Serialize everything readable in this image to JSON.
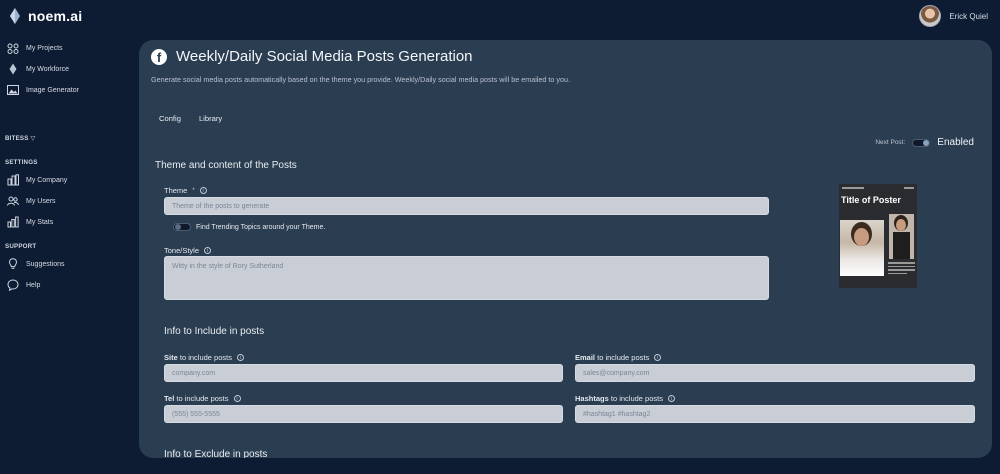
{
  "app": {
    "logo_text": "noem.ai",
    "user_name": "Erick Quiel"
  },
  "sidebar": {
    "items": [
      {
        "label": "My Projects",
        "icon": "projects-icon"
      },
      {
        "label": "My Workforce",
        "icon": "workforce-icon"
      },
      {
        "label": "Image Generator",
        "icon": "image-icon"
      }
    ],
    "bitess_label": "BITESS",
    "settings_label": "SETTINGS",
    "settings_items": [
      {
        "label": "My Company",
        "icon": "company-icon"
      },
      {
        "label": "My Users",
        "icon": "users-icon"
      },
      {
        "label": "My Stats",
        "icon": "stats-icon"
      }
    ],
    "support_label": "SUPPORT",
    "support_items": [
      {
        "label": "Suggestions",
        "icon": "lightbulb-icon"
      },
      {
        "label": "Help",
        "icon": "help-icon"
      }
    ]
  },
  "main": {
    "title": "Weekly/Daily Social Media Posts Generation",
    "subtitle": "Generate social media posts automatically based on the theme you provide. Weekly/Daily social media posts will be emailed to you.",
    "tabs": [
      {
        "label": "Config"
      },
      {
        "label": "Library"
      }
    ],
    "next_post_label": "Next Post:",
    "next_post_status": "Enabled",
    "theme_section_title": "Theme and content of the Posts",
    "theme": {
      "label": "Theme",
      "required_mark": "*",
      "placeholder": "Theme of the posts to generate"
    },
    "trending_label": "Find Trending Topics around your Theme.",
    "tone": {
      "label": "Tone/Style",
      "placeholder": "Witty in the style of Rory Sutherland"
    },
    "include_section_title": "Info to Include in posts",
    "site": {
      "label_bold": "Site",
      "label_rest": "to include posts",
      "placeholder": "company.com"
    },
    "email": {
      "label_bold": "Email",
      "label_rest": "to include posts",
      "placeholder": "sales@company.com"
    },
    "tel": {
      "label_bold": "Tel",
      "label_rest": "to include posts",
      "placeholder": "(555) 555-5555"
    },
    "hashtags": {
      "label_bold": "Hashtags",
      "label_rest": "to include posts",
      "placeholder": "#hashtag1 #hashtag2"
    },
    "exclude_section_title": "Info to Exclude in posts",
    "poster": {
      "title": "Title of Poster"
    }
  },
  "colors": {
    "background": "#0d1b33",
    "panel": "#2b3d50",
    "input": "#c9ced6"
  }
}
